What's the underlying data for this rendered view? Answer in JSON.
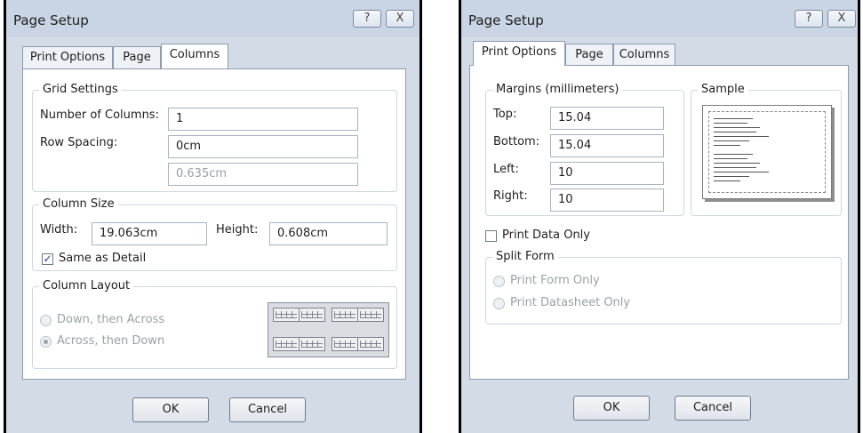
{
  "left_dialog": {
    "title": "Page Setup",
    "help_glyph": "?",
    "close_glyph": "X",
    "tabs": [
      "Print Options",
      "Page",
      "Columns"
    ],
    "active_tab": "Columns",
    "grid_settings": {
      "legend": "Grid Settings",
      "number_of_columns_label": "Number of Columns:",
      "number_of_columns_value": "1",
      "row_spacing_label": "Row Spacing:",
      "row_spacing_value": "0cm",
      "column_spacing_value": "0.635cm"
    },
    "column_size": {
      "legend": "Column Size",
      "width_label": "Width:",
      "width_value": "19.063cm",
      "height_label": "Height:",
      "height_value": "0.608cm",
      "same_as_detail_label": "Same as Detail",
      "same_as_detail_checked": true
    },
    "column_layout": {
      "legend": "Column Layout",
      "options": [
        "Down, then Across",
        "Across, then Down"
      ],
      "selected": "Across, then Down",
      "icon": "column-layout-preview-icon"
    },
    "ok_label": "OK",
    "cancel_label": "Cancel"
  },
  "right_dialog": {
    "title": "Page Setup",
    "help_glyph": "?",
    "close_glyph": "X",
    "tabs": [
      "Print Options",
      "Page",
      "Columns"
    ],
    "active_tab": "Print Options",
    "margins": {
      "legend": "Margins (millimeters)",
      "top_label": "Top:",
      "top_value": "15.04",
      "bottom_label": "Bottom:",
      "bottom_value": "15.04",
      "left_label": "Left:",
      "left_value": "10",
      "right_label": "Right:",
      "right_value": "10"
    },
    "sample": {
      "legend": "Sample",
      "icon": "page-sample-preview-icon"
    },
    "print_data_only_label": "Print Data Only",
    "print_data_only_checked": false,
    "split_form": {
      "legend": "Split Form",
      "options": [
        "Print Form Only",
        "Print Datasheet Only"
      ]
    },
    "ok_label": "OK",
    "cancel_label": "Cancel"
  },
  "colors": {
    "dialog_bg": "#d3dbe7",
    "panel_bg": "#ffffff",
    "border": "#8d9bb0",
    "disabled_text": "#9aa0a8",
    "check_mark": "#1c3d8c"
  }
}
